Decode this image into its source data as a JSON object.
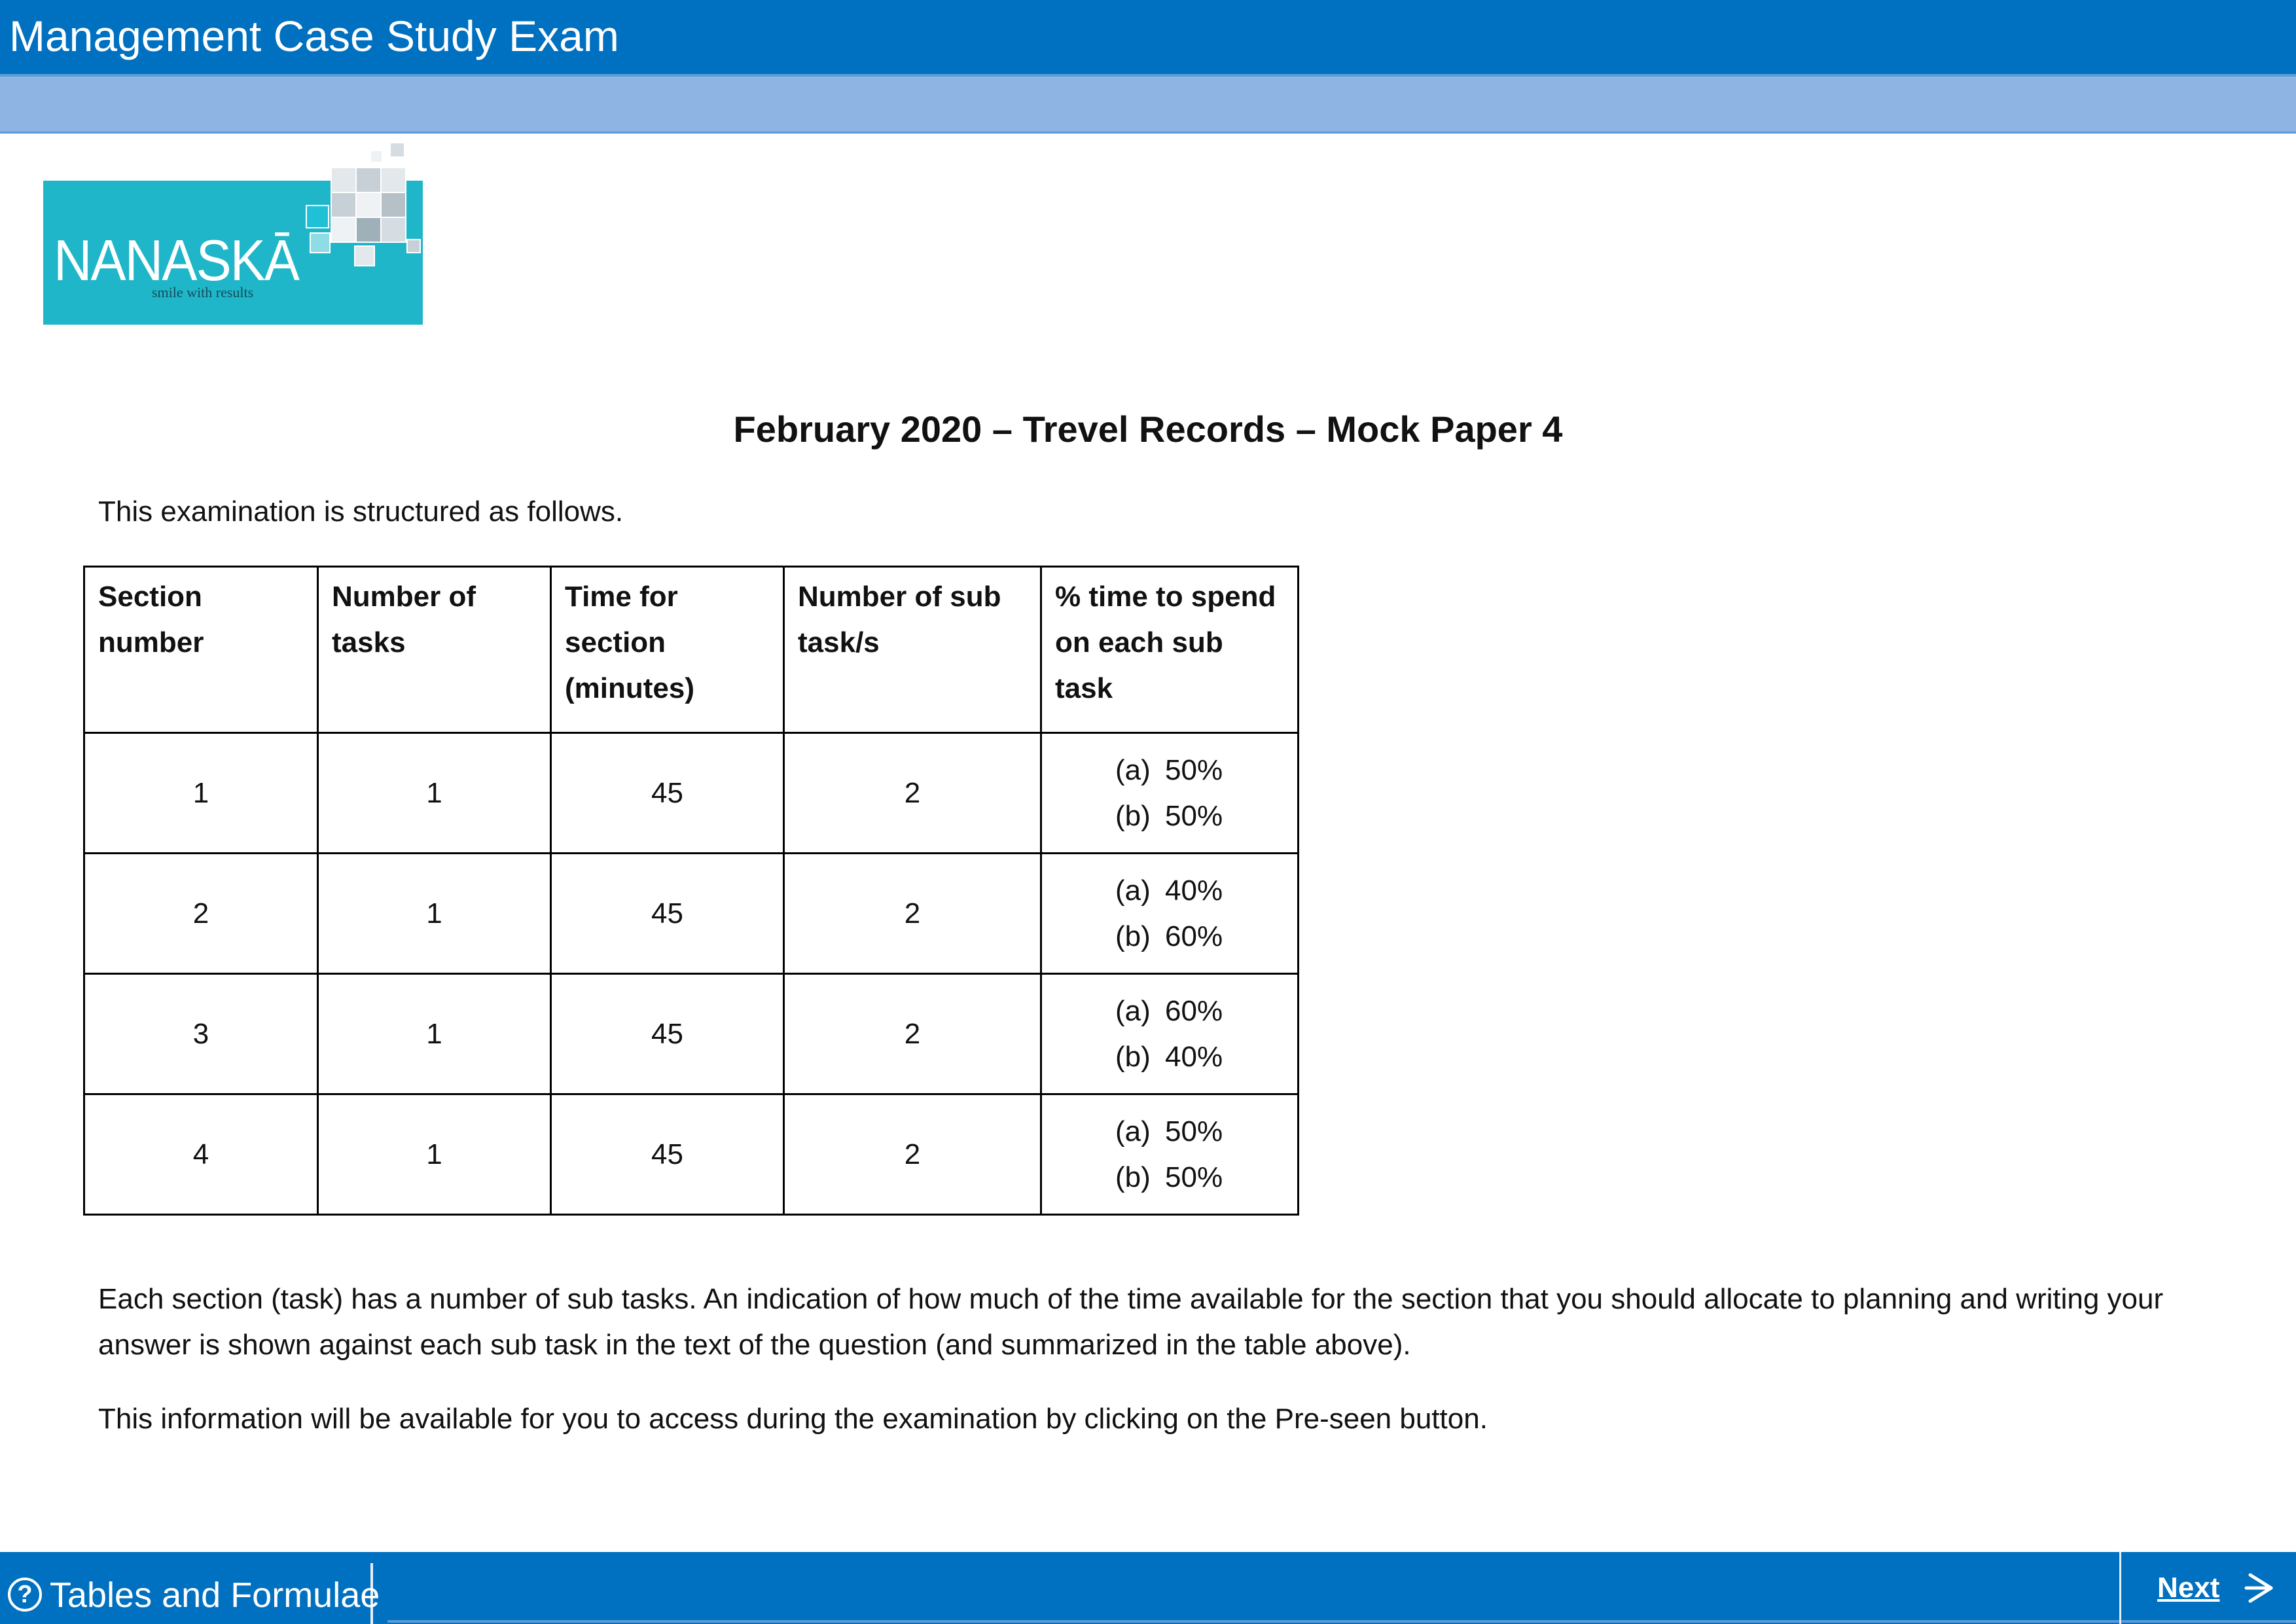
{
  "header": {
    "title": "Management Case Study Exam"
  },
  "logo": {
    "brand": "NANASKĀ",
    "tagline": "smile with results"
  },
  "main": {
    "heading": "February 2020 – Trevel Records – Mock Paper 4",
    "intro": "This examination is structured as follows.",
    "table": {
      "headers": [
        "Section number",
        "Number of tasks",
        "Time for section (minutes)",
        "Number of sub task/s",
        "% time to spend on each sub task"
      ],
      "rows": [
        {
          "section": "1",
          "tasks": "1",
          "time": "45",
          "subtasks": "2",
          "a": "50%",
          "b": "50%"
        },
        {
          "section": "2",
          "tasks": "1",
          "time": "45",
          "subtasks": "2",
          "a": "40%",
          "b": "60%"
        },
        {
          "section": "3",
          "tasks": "1",
          "time": "45",
          "subtasks": "2",
          "a": "60%",
          "b": "40%"
        },
        {
          "section": "4",
          "tasks": "1",
          "time": "45",
          "subtasks": "2",
          "a": "50%",
          "b": "50%"
        }
      ],
      "sub_labels": {
        "a": "(a)",
        "b": "(b)"
      }
    },
    "paragraph1": "Each section (task) has a number of sub tasks. An indication of how much of the time available for the section that you should allocate to planning and writing your answer is shown against each sub task in the text of the question (and summarized in the table above).",
    "paragraph2": "This information will be available for you to access during the examination by clicking on the Pre-seen button."
  },
  "footer": {
    "tables_label": "Tables and Formulae",
    "help_icon": "question-circle-icon",
    "next_label": "Next",
    "next_icon": "arrow-right-icon"
  },
  "colors": {
    "titlebar": "#0070c0",
    "subbar": "#8db4e2",
    "logo_bg": "#1fb6c9"
  }
}
